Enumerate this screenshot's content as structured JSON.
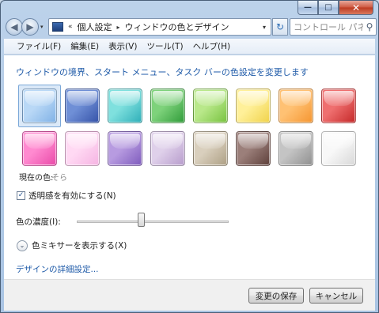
{
  "window": {
    "caption_minimize": "—",
    "caption_maximize": "□",
    "caption_close": "✕"
  },
  "nav": {
    "back_glyph": "◀",
    "forward_glyph": "▶",
    "dropdown_glyph": "▾",
    "breadcrumb_root_glyph": "«",
    "breadcrumb": [
      "個人設定",
      "ウィンドウの色とデザイン"
    ],
    "breadcrumb_separator": "▸",
    "address_dropdown_glyph": "▾",
    "refresh_glyph": "↻",
    "search_placeholder": "コントロール パネ..."
  },
  "menu": [
    "ファイル(F)",
    "編集(E)",
    "表示(V)",
    "ツール(T)",
    "ヘルプ(H)"
  ],
  "content": {
    "headline": "ウィンドウの境界、スタート メニュー、タスク バーの色設定を変更します",
    "swatches_row1": [
      {
        "name": "sky",
        "color": "#b9d8f6",
        "dark": "#7fb1e6"
      },
      {
        "name": "twilight",
        "color": "#6f8fd6",
        "dark": "#3552a8"
      },
      {
        "name": "sea-foam",
        "color": "#7fe0de",
        "dark": "#2eaeb8"
      },
      {
        "name": "leaf",
        "color": "#7ed27b",
        "dark": "#2f9b39"
      },
      {
        "name": "lime",
        "color": "#b9e88a",
        "dark": "#77c23f"
      },
      {
        "name": "pumpkin-light",
        "color": "#fff099",
        "dark": "#f0d24a"
      },
      {
        "name": "pumpkin",
        "color": "#ffc173",
        "dark": "#f59530"
      },
      {
        "name": "ruby",
        "color": "#ef6f6f",
        "dark": "#c42828"
      }
    ],
    "swatches_row2": [
      {
        "name": "fuchsia",
        "color": "#ff8ad0",
        "dark": "#e94aa8"
      },
      {
        "name": "blush",
        "color": "#ffd9f3",
        "dark": "#f5b3e2"
      },
      {
        "name": "violet",
        "color": "#b79be0",
        "dark": "#7e5bbd"
      },
      {
        "name": "lavender",
        "color": "#dfd0ea",
        "dark": "#b79ccc"
      },
      {
        "name": "taupe",
        "color": "#d9cfbd",
        "dark": "#ad9f84"
      },
      {
        "name": "chocolate",
        "color": "#9b7f7a",
        "dark": "#5d3f3a"
      },
      {
        "name": "slate",
        "color": "#c4c4c4",
        "dark": "#8f8f8f"
      },
      {
        "name": "frost",
        "color": "#f8f8f8",
        "dark": "#d8d8d8"
      }
    ],
    "current_color_label": "現在の色:",
    "current_color_value": "そら",
    "transparency_label": "透明感を有効にする(N)",
    "transparency_checked": true,
    "check_glyph": "✓",
    "intensity_label": "色の濃度(I):",
    "intensity_value": 0.42,
    "mixer_label": "色ミキサーを表示する(X)",
    "mixer_glyph": "⌄",
    "advanced_link": "デザインの詳細設定..."
  },
  "buttons": {
    "save": "変更の保存",
    "cancel": "キャンセル"
  }
}
